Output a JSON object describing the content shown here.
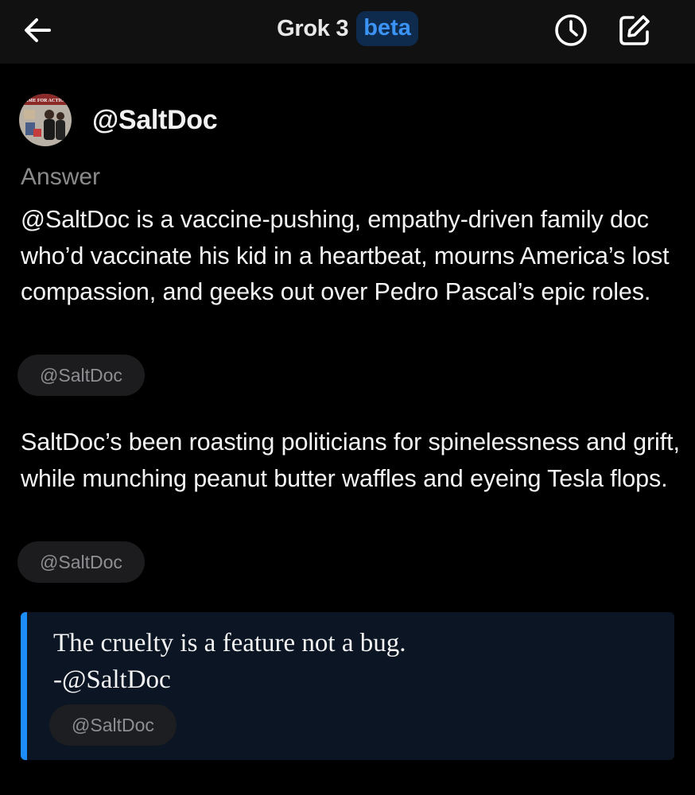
{
  "header": {
    "title": "Grok 3",
    "badge": "beta",
    "back_icon": "arrow-left-icon",
    "history_icon": "clock-icon",
    "new_chat_icon": "compose-icon"
  },
  "profile": {
    "handle": "@SaltDoc",
    "avatar_caption": "TIME FOR ACTION"
  },
  "answer": {
    "label": "Answer",
    "paragraphs": [
      {
        "text": "@SaltDoc is a vaccine-pushing, empathy-driven family doc who’d vaccinate his kid in a heartbeat, mourns America’s lost compassion, and geeks out over Pedro Pascal’s epic roles.",
        "source_chip": "@SaltDoc"
      },
      {
        "text": "SaltDoc’s been roasting politicians for spinelessness and grift, while munching peanut butter waffles and eyeing Tesla flops.",
        "source_chip": "@SaltDoc"
      }
    ],
    "quote": {
      "text": "The cruelty is a feature not a bug.\n-@SaltDoc",
      "source_chip": "@SaltDoc"
    }
  },
  "colors": {
    "background": "#000000",
    "header_background": "#111111",
    "accent": "#1d8cf8",
    "chip_background": "#1c1c1e",
    "muted_text": "#8a8a8a"
  }
}
